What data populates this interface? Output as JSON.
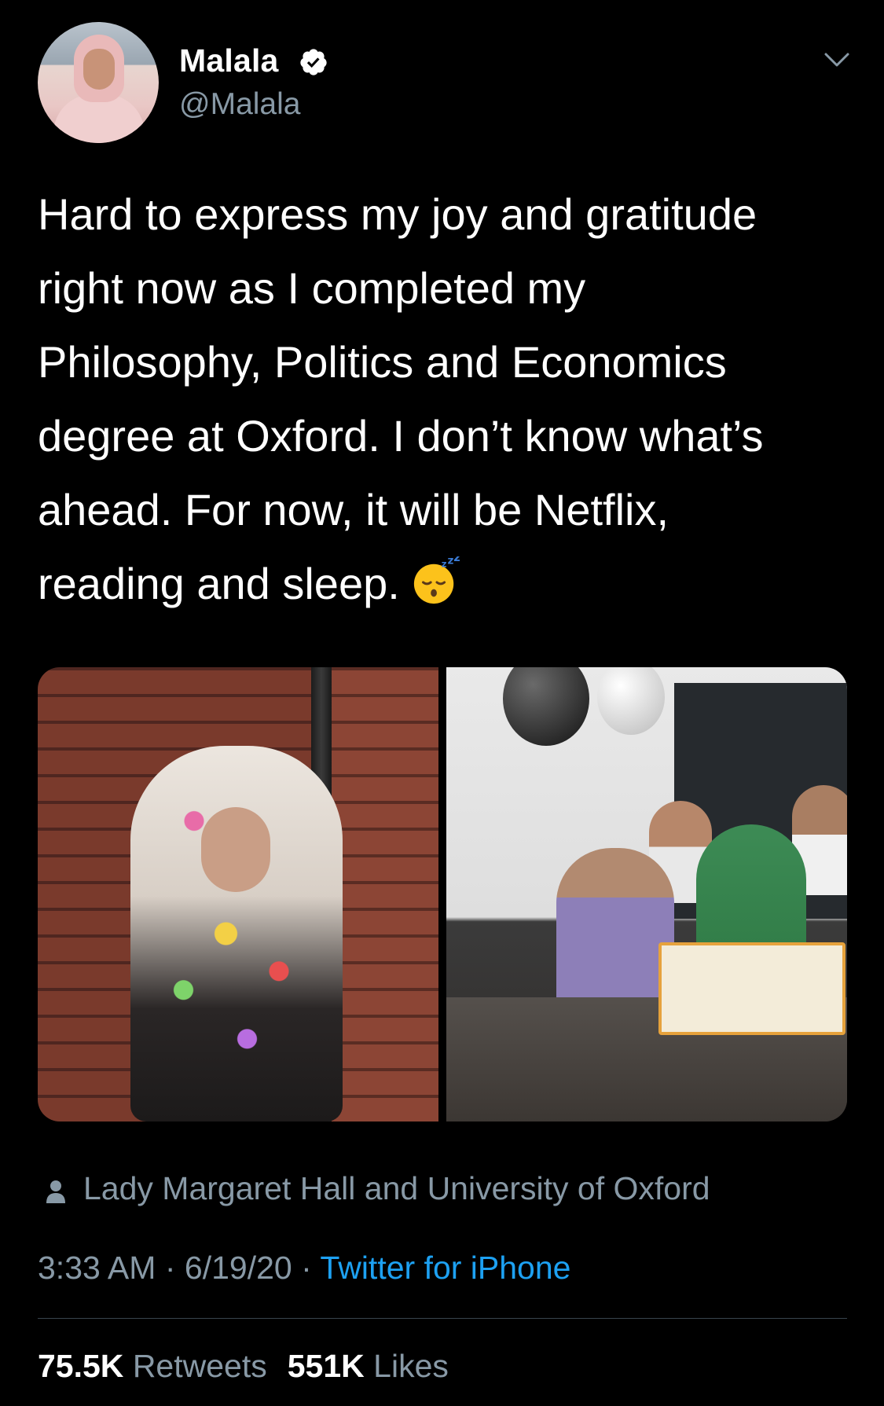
{
  "author": {
    "name": "Malala",
    "handle": "@Malala",
    "verified": true
  },
  "tweet": {
    "lines": [
      "Hard to express my joy and gratitude",
      "right now as I completed my",
      "Philosophy, Politics and Economics",
      "degree at Oxford. I don’t know what’s",
      "ahead. For now, it will be Netflix,",
      "reading and sleep."
    ],
    "emoji": "sleeping-face"
  },
  "media": {
    "photos": [
      "photo-left",
      "photo-right"
    ]
  },
  "location": "Lady Margaret Hall and University of Oxford",
  "meta": {
    "time": "3:33 AM",
    "separator": "·",
    "date": "6/19/20",
    "source": "Twitter for iPhone"
  },
  "stats": {
    "retweets_count": "75.5K",
    "retweets_label": "Retweets",
    "likes_count": "551K",
    "likes_label": "Likes"
  },
  "colors": {
    "background": "#000000",
    "secondary_text": "#8899a6",
    "link": "#1da1f2",
    "divider": "#38444d"
  }
}
